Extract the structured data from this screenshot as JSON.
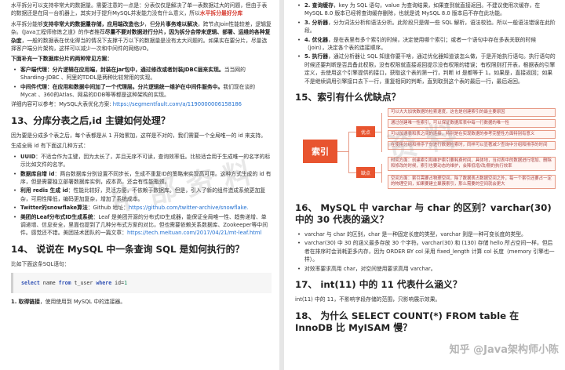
{
  "left": {
    "intro_p1": "水平拆分可以支持非常大的数据量。需要注意的一点是：分表仅仅是解决了单一表数据过大的问题，但由于表的数据还是在同一台机器上，其实对于提升MySQL并发能力没有什么意义，所以",
    "intro_p1_bold": "水平拆分最好分库",
    "intro_p2_a": "水平拆分能够",
    "intro_p2_b": "支持非常大的数据量存储，应用端改造也少",
    "intro_p2_c": "，但",
    "intro_p2_d": "分片事务难以解决",
    "intro_p2_e": "，跨节点Join性能较差，逻辑复杂。《Java工程师修炼之道》的作者推荐",
    "intro_p2_f": "尽量不要对数据进行分片，因为拆分会带来逻辑、部署、运维的各种复杂度",
    "intro_p2_g": "，一般的数据表在优化得当的情况下支撑千万以下的数据量是没有太大问题的。如果实在要分片，尽量选择客户端分片架构，这样可以减少一次和中间件的网络I/O。",
    "subhead": "下面补充一下数据库分片的两种常见方案：",
    "plans": [
      {
        "bold": "客户端代理：分片逻辑在应用端，封装在jar包中，通过修改或者封装JDBC层来实现。",
        "rest": "当当网的 Sharding-JDBC 、阿里的TDDL是两种比较常用的实现。"
      },
      {
        "bold": "中间件代理：在应用和数据中间加了一个代理层。分片逻辑统一维护在中间件服务中。",
        "rest": "我们现在谈的 Mycat 、360的Atlas、网易的DDB等等都是这种架构的实现。"
      }
    ],
    "detail_label": "详细内容可以参考：MySQL大表优化方案:",
    "detail_link": "https://segmentfault.com/a/1190000006158186",
    "h13": "13、分库分表之后,id 主键如何处理？",
    "h13_p1": "因为要是分成多个表之后，每个表都是从 1 开始累加，这样是不对的，我们需要一个全局唯一的 id 来支持。",
    "h13_p2": "生成全局 id 有下面这几种方式：",
    "id_items": [
      {
        "bold": "UUID",
        "rest": "：不适合作为主键，因为太长了，并且无序不可读，查询效率低。比较适合用于生成唯一的名字的标示比如文件的名字。"
      },
      {
        "bold": "数据库自增 id",
        "rest": "：两台数据库分别设置不同步长，生成不重复ID的策略来实现高可用。这种方式生成的 id 有序，但是需要独立部署数据库实例，成本高，还会有性能瓶颈。"
      },
      {
        "bold": "利用 redis 生成 id",
        "rest": "：性能比较好，灵活方便，不依赖于数据库。但是，引入了新的组件造成系统更加复杂，可用性降低，编码更加复杂，增加了系统成本。"
      },
      {
        "bold": "Twitter的snowflake算法",
        "rest": "：Github 地址：",
        "link": "https://github.com/twitter-archive/snowflake."
      },
      {
        "bold": "美团的Leaf分布式ID生成系统",
        "rest": "：Leaf 是美团开源的分布式ID生成器，能保证全局唯一性、趋势递增、单调递增、信息安全，里面也提到了几种分布式方案的对比，但也需要依赖关系数据库、Zookeeper等中间件。感觉还不错。美团技术团队的一篇文章：",
        "link": "https://tech.meituan.com/2017/04/21/mt-leaf.html"
      }
    ],
    "h14": "14、 说说在 MySQL 中一条查询 SQL 是如何执行的？",
    "h14_p1": "比如下面这条SQL语句：",
    "code": {
      "kw1": "select",
      "mid1": " name ",
      "kw2": "from",
      "mid2": " t_user ",
      "kw3": "where",
      "mid3": " id=",
      "num": "1"
    },
    "step1_bold": "1. 取得链接",
    "step1_rest": "，使用使用到 MySQL 中的连接器。"
  },
  "right": {
    "steps": [
      {
        "bold": "2. 查询缓存",
        "rest": "，key 为 SQL 语句，value 为查询结果，如果查到就直接返回。不建议使用次缓存，在 MySQL 8.0 版本已经将查询缓存删除，也就是说 MySQL 8.0 版本后不存在此功能。"
      },
      {
        "bold": "3. 分析器",
        "rest": "，分为词法分析和语法分析。此阶段只是做一些 SQL 解析，语法校验。所以一般语法错误在此阶段。"
      },
      {
        "bold": "4. 优化器",
        "rest": "，是在表里有多个索引的时候，决定使用哪个索引；或者一个语句中存在多表关联的时候（join），决定各个表的连接顺序。"
      },
      {
        "bold": "5. 执行器",
        "rest": "，通过分析器让 SQL 知道你要干啥，通过优化器知道该怎么做，于是开始执行语句。执行语句的时候还要判断是否具备此权限，没有权限就直接返回提示没有权限的错误；有权限则打开表，根据表的引擎定义，去使用这个引擎提供的接口，获取这个表的第一行，判断 id 是都等于 1。如果是，直接返回；如果不是继续调用引擎接口去下一行，重复相同的判断，直到取到这个表的最后一行，最后返回。"
      }
    ],
    "h15": "15、索引有什么优缺点？",
    "mindmap": {
      "root": "索引",
      "pros": "优点",
      "cons": "缺点",
      "pros_items": [
        "可以大大加快数据的检索速度，这也是创建索引的最主要原因",
        "通过创建唯一性索引，可以保证数据库表中每一行数据的唯一性",
        "可以加速表和表之间的连接，特别是在实现数据的参考完整性方面特别有意义",
        "在使用分组和排序子句进行数据检索时，同样可以显著减少查询中分组和排序的时间"
      ],
      "cons_items": [
        "时间方面：创建索引和维护索引要耗费时间，具体地，当对表中的数据进行增加、删除和修改的时候，索引也要动态的维护，会降低增/改/删的执行效率",
        "空间方面：索引需要占物理空间，除了数据表占数据空间之外，每一个索引还要占一定的物理空间，如果要建立聚簇索引，那么需要的空间就会更大"
      ]
    },
    "h16": "16、 MySQL 中 varchar 与 char 的区别？varchar(30) 中的 30 代表的涵义？",
    "h16_items": [
      "varchar 与 char 的区别，char 是一种固定长度的类型，varchar 则是一种可变长度的类型。",
      "varchar(30) 中 30 的涵义最多存放 30 个字符。varchar(30) 和 (130) 存储 hello 所占空间一样，但后者在排序时会消耗更多内存，因为 ORDER BY col 采用 fixed_length 计算 col 长度（memory 引擎也一样）。",
      "对效率要求高用 char，对空间使用要求高用 varchar。"
    ],
    "h17": "17、 int(11) 中的 11 代表什么涵义？",
    "h17_p": "int(11) 中的 11，不影响字段存储的范围，只影响展示效果。",
    "h18": "18、 为什么 SELECT COUNT(*) FROM table 在 InnoDB 比 MyISAM 慢？",
    "watermark_zhihu": "知乎 @Java架构师小陈"
  },
  "colors": {
    "accent_red": "#d63a2f",
    "link_blue": "#1f6fd1",
    "mindmap_orange": "#e8542f"
  }
}
